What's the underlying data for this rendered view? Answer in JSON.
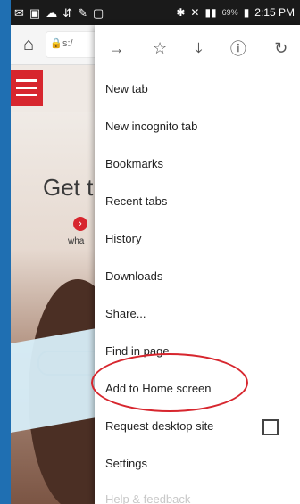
{
  "status": {
    "icons": [
      "mail-icon",
      "image-icon",
      "cloud-icon",
      "usb-icon",
      "tools-icon",
      "square-icon"
    ],
    "battery": "69%",
    "time": "2:15 PM"
  },
  "browser": {
    "url_partial": "s:/"
  },
  "page": {
    "headline_partial": "Get t",
    "subtext_partial": "wha"
  },
  "menu": {
    "items": [
      {
        "label": "New tab"
      },
      {
        "label": "New incognito tab"
      },
      {
        "label": "Bookmarks"
      },
      {
        "label": "Recent tabs"
      },
      {
        "label": "History"
      },
      {
        "label": "Downloads"
      },
      {
        "label": "Share..."
      },
      {
        "label": "Find in page"
      },
      {
        "label": "Add to Home screen"
      },
      {
        "label": "Request desktop site"
      },
      {
        "label": "Settings"
      }
    ],
    "faded_label": "Help & feedback"
  },
  "colors": {
    "accent_red": "#d7262e",
    "brand_blue": "#1f6fb2"
  }
}
